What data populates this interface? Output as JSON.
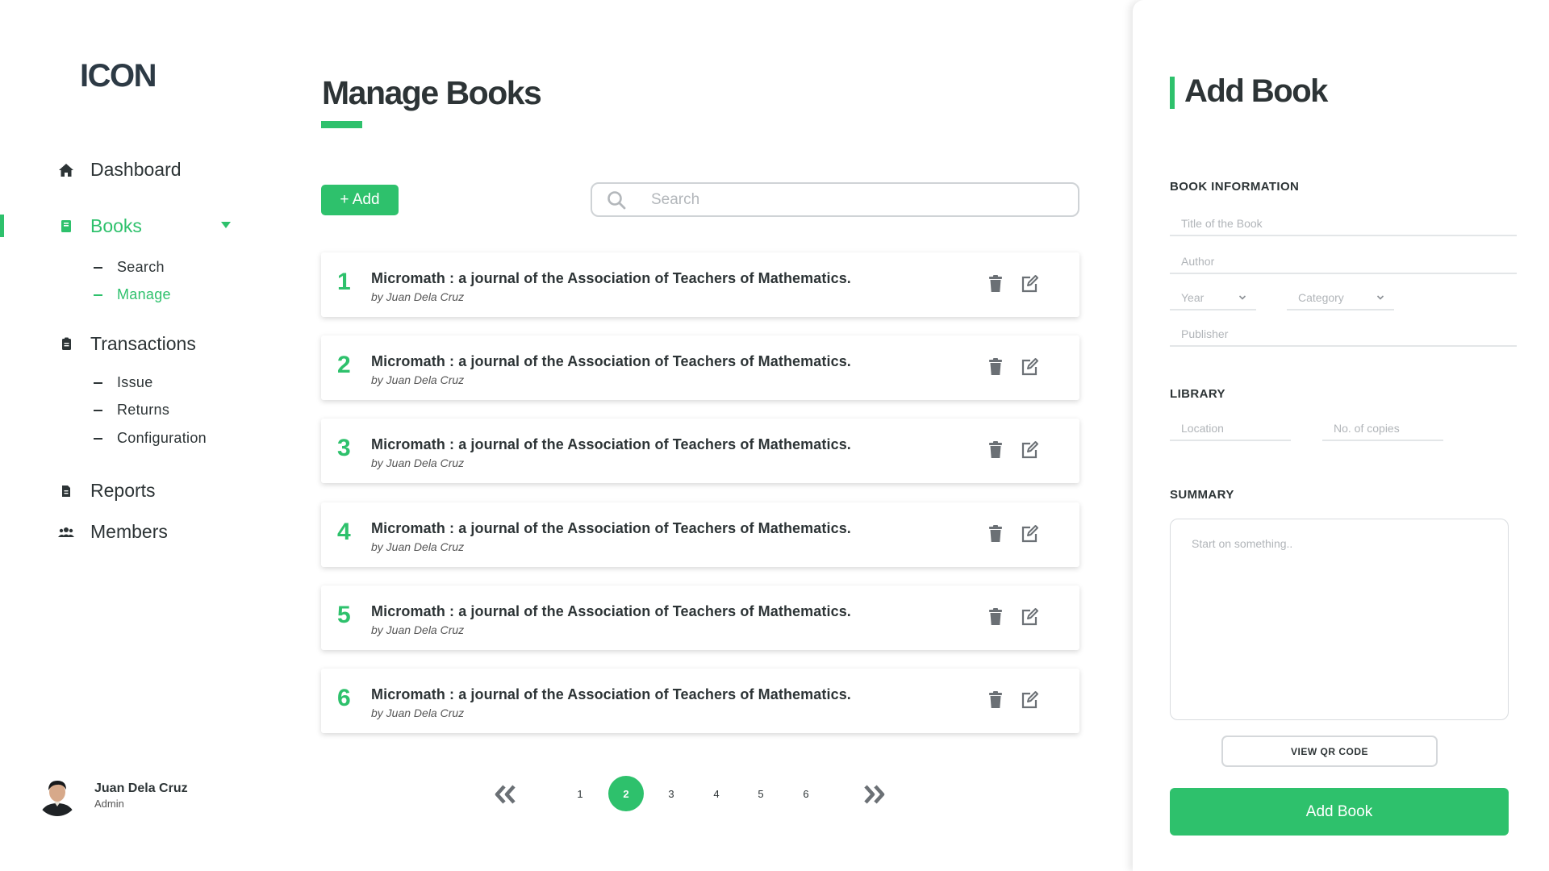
{
  "sidebar": {
    "logo": "ICON",
    "nav": {
      "dashboard": "Dashboard",
      "books": "Books",
      "books_sub": {
        "search": "Search",
        "manage": "Manage"
      },
      "transactions": "Transactions",
      "transactions_sub": {
        "issue": "Issue",
        "returns": "Returns",
        "configuration": "Configuration"
      },
      "reports": "Reports",
      "members": "Members"
    },
    "user": {
      "name": "Juan Dela Cruz",
      "role": "Admin"
    }
  },
  "main": {
    "title": "Manage Books",
    "add_label": "+ Add",
    "search_placeholder": "Search",
    "books": [
      {
        "num": "1",
        "title": "Micromath : a journal of the Association of Teachers of Mathematics.",
        "author": "by Juan Dela Cruz"
      },
      {
        "num": "2",
        "title": "Micromath : a journal of the Association of Teachers of Mathematics.",
        "author": "by Juan Dela Cruz"
      },
      {
        "num": "3",
        "title": "Micromath : a journal of the Association of Teachers of Mathematics.",
        "author": "by Juan Dela Cruz"
      },
      {
        "num": "4",
        "title": "Micromath : a journal of the Association of Teachers of Mathematics.",
        "author": "by Juan Dela Cruz"
      },
      {
        "num": "5",
        "title": "Micromath : a journal of the Association of Teachers of Mathematics.",
        "author": "by Juan Dela Cruz"
      },
      {
        "num": "6",
        "title": "Micromath : a journal of the Association of Teachers of Mathematics.",
        "author": "by Juan Dela Cruz"
      }
    ],
    "pagination": {
      "pages": [
        "1",
        "2",
        "3",
        "4",
        "5",
        "6"
      ],
      "current": "2"
    }
  },
  "panel": {
    "title": "Add Book",
    "book_info_label": "BOOK INFORMATION",
    "title_placeholder": "Title of the Book",
    "author_placeholder": "Author",
    "year_placeholder": "Year",
    "category_placeholder": "Category",
    "publisher_placeholder": "Publisher",
    "library_label": "LIBRARY",
    "location_placeholder": "Location",
    "copies_placeholder": "No. of copies",
    "summary_label": "SUMMARY",
    "summary_placeholder": "Start on something..",
    "qr_label": "VIEW QR CODE",
    "submit_label": "Add Book"
  },
  "colors": {
    "accent": "#2ec16c",
    "text": "#2d3436",
    "muted": "#b1b5b9"
  },
  "icons": [
    "home-icon",
    "book-icon",
    "clipboard-icon",
    "file-icon",
    "users-icon",
    "search-icon",
    "trash-icon",
    "edit-icon",
    "double-chevron-left-icon",
    "double-chevron-right-icon",
    "chevron-down-icon"
  ]
}
